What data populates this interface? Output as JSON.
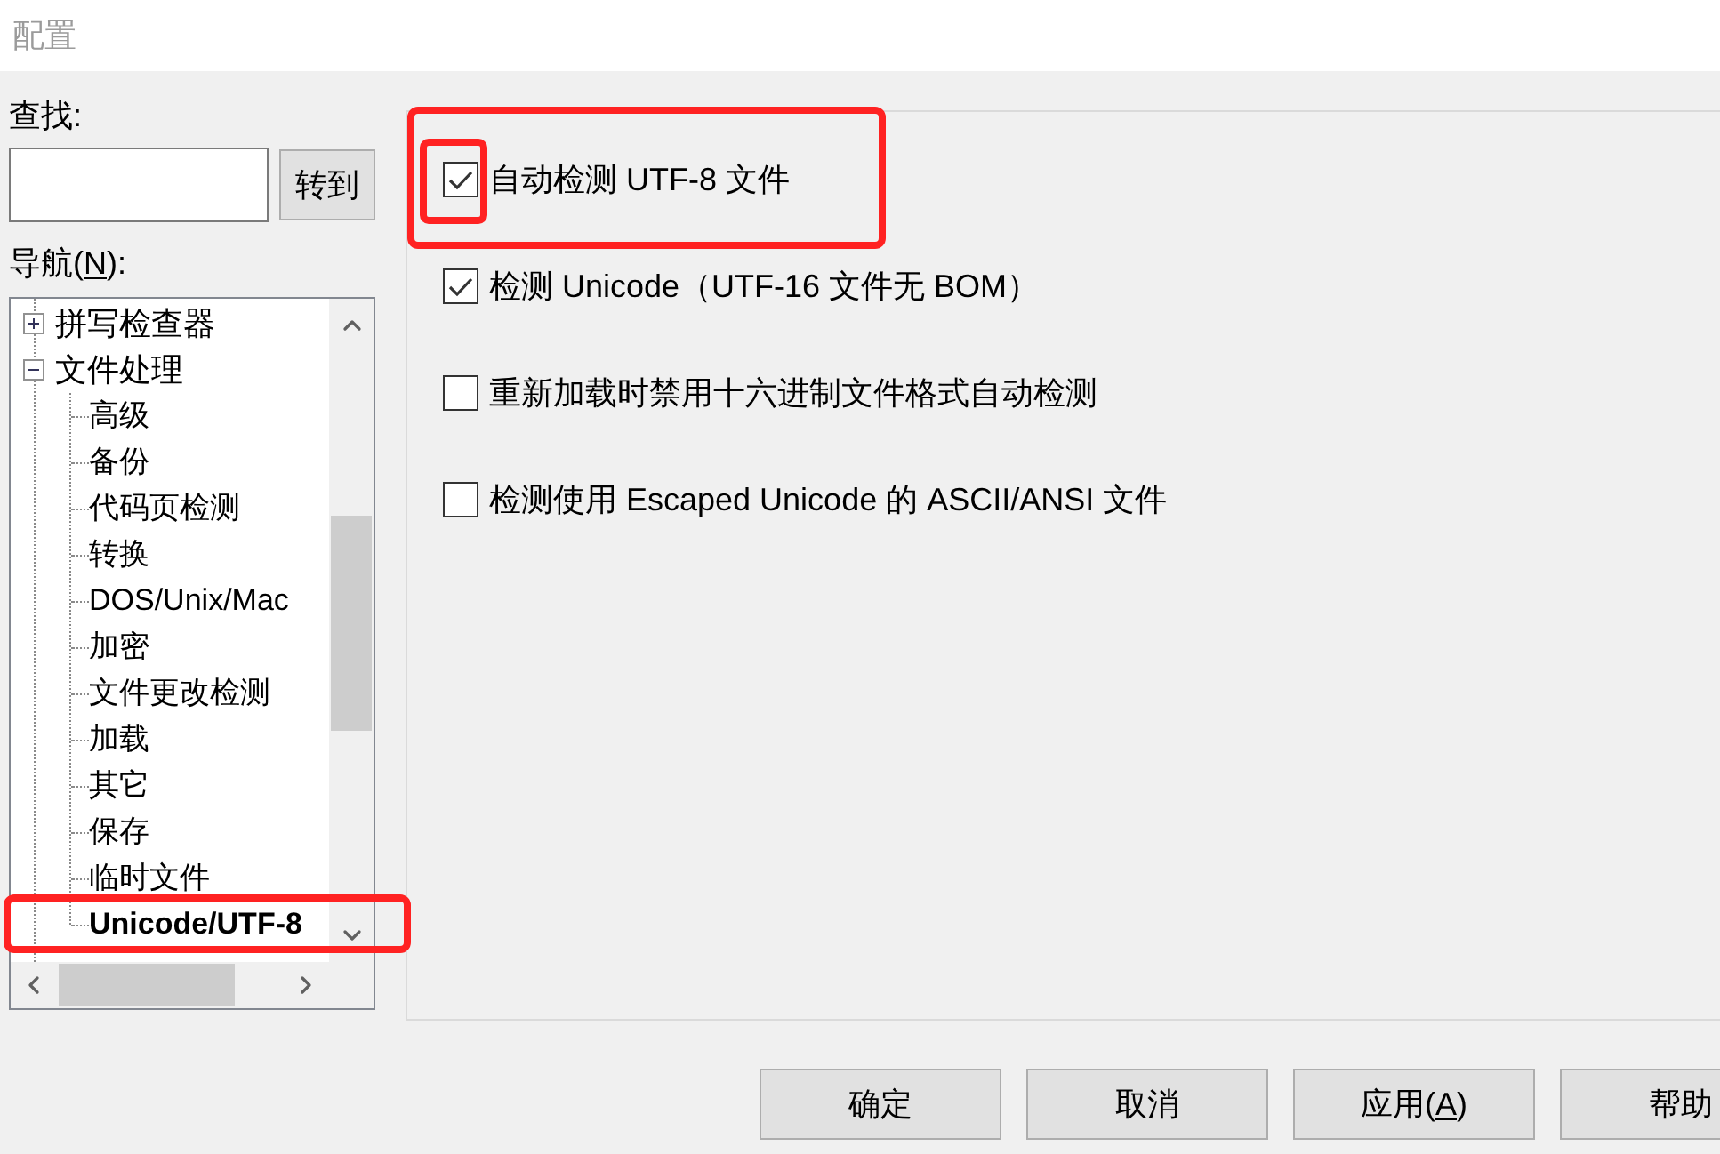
{
  "window": {
    "title": "配置"
  },
  "search": {
    "label": "查找:",
    "button": "转到"
  },
  "navigation": {
    "label": "导航(",
    "access_key": "N",
    "label_after": "):"
  },
  "tree": [
    {
      "label": "拼写检查器",
      "expanded": false,
      "selected": false,
      "highlighted": false
    },
    {
      "label": "文件处理",
      "expanded": true,
      "selected": false,
      "highlighted": false,
      "children": [
        {
          "label": "高级",
          "selected": false,
          "highlighted": false
        },
        {
          "label": "备份",
          "selected": false,
          "highlighted": false
        },
        {
          "label": "代码页检测",
          "selected": false,
          "highlighted": false
        },
        {
          "label": "转换",
          "selected": false,
          "highlighted": false
        },
        {
          "label": "DOS/Unix/Mac",
          "selected": false,
          "highlighted": false
        },
        {
          "label": "加密",
          "selected": false,
          "highlighted": false
        },
        {
          "label": "文件更改检测",
          "selected": false,
          "highlighted": false
        },
        {
          "label": "加载",
          "selected": false,
          "highlighted": false
        },
        {
          "label": "其它",
          "selected": false,
          "highlighted": false
        },
        {
          "label": "保存",
          "selected": false,
          "highlighted": false
        },
        {
          "label": "临时文件",
          "selected": false,
          "highlighted": false
        },
        {
          "label": "Unicode/UTF-8",
          "selected": true,
          "highlighted": true
        }
      ]
    }
  ],
  "options": [
    {
      "label": "自动检测 UTF-8 文件",
      "checked": true,
      "highlighted": true,
      "checkbox_highlighted": true
    },
    {
      "label": "检测 Unicode（UTF-16 文件无 BOM）",
      "checked": true,
      "highlighted": false,
      "checkbox_highlighted": false
    },
    {
      "label": "重新加载时禁用十六进制文件格式自动检测",
      "checked": false,
      "highlighted": false,
      "checkbox_highlighted": false
    },
    {
      "label": "检测使用 Escaped Unicode 的 ASCII/ANSI 文件",
      "checked": false,
      "highlighted": false,
      "checkbox_highlighted": false
    }
  ],
  "buttons": [
    {
      "label": "确定"
    },
    {
      "label": "取消"
    },
    {
      "label": "应用(",
      "access_key": "A",
      "label_after": ")"
    },
    {
      "label": "帮助"
    }
  ]
}
